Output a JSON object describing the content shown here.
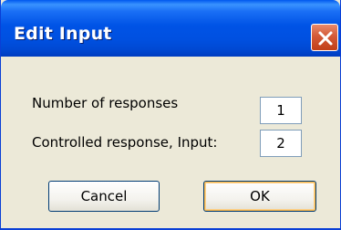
{
  "window": {
    "title": "Edit Input"
  },
  "form": {
    "responses_label": "Number of responses",
    "responses_value": "1",
    "controlled_label": "Controlled response, Input:",
    "controlled_value": "2"
  },
  "buttons": {
    "cancel_label": "Cancel",
    "ok_label": "OK"
  },
  "icons": {
    "close": "close-icon"
  },
  "colors": {
    "titlebar": "#0053e6",
    "close_button": "#d45a37",
    "dialog_background": "#ece9d8"
  }
}
